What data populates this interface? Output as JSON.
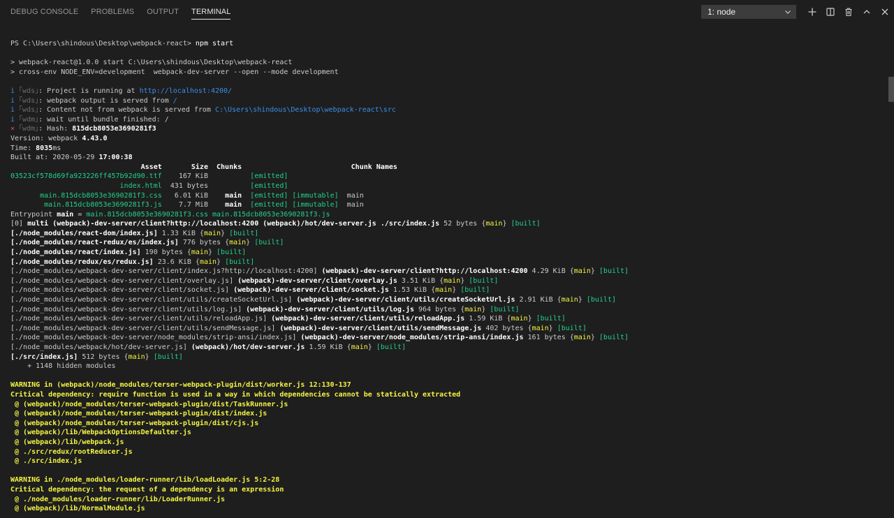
{
  "tabs": [
    {
      "label": "DEBUG CONSOLE",
      "active": false
    },
    {
      "label": "PROBLEMS",
      "active": false
    },
    {
      "label": "OUTPUT",
      "active": false
    },
    {
      "label": "TERMINAL",
      "active": true
    }
  ],
  "terminal_select": {
    "value": "1: node"
  },
  "icons": [
    "plus-icon",
    "split-icon",
    "trash-icon",
    "chevron-up-icon",
    "close-icon"
  ],
  "colors": {
    "green": "#23d18b",
    "yellow": "#f5f543",
    "blue": "#3b8eea",
    "red": "#f14c4c",
    "gray": "#6d6d6d"
  },
  "terminal_lines": [
    [
      {
        "t": "PS C:\\Users\\shindous\\Desktop\\webpack-react> ",
        "c": "dim"
      },
      {
        "t": "npm start",
        "c": "white"
      }
    ],
    [],
    [
      {
        "t": "> webpack-react@1.0.0 start C:\\Users\\shindous\\Desktop\\webpack-react",
        "c": "dim"
      }
    ],
    [
      {
        "t": "> cross-env NODE_ENV=development  webpack-dev-server --open --mode development",
        "c": "dim"
      }
    ],
    [],
    [
      {
        "t": "i ",
        "c": "blue"
      },
      {
        "t": "｢wds｣",
        "c": "gray"
      },
      {
        "t": ": Project is running at ",
        "c": "dim"
      },
      {
        "t": "http://localhost:4200/",
        "c": "blue"
      }
    ],
    [
      {
        "t": "i ",
        "c": "blue"
      },
      {
        "t": "｢wds｣",
        "c": "gray"
      },
      {
        "t": ": webpack output is served from ",
        "c": "dim"
      },
      {
        "t": "/",
        "c": "blue"
      }
    ],
    [
      {
        "t": "i ",
        "c": "blue"
      },
      {
        "t": "｢wds｣",
        "c": "gray"
      },
      {
        "t": ": Content not from webpack is served from ",
        "c": "dim"
      },
      {
        "t": "C:\\Users\\shindous\\Desktop\\webpack-react\\src",
        "c": "blue"
      }
    ],
    [
      {
        "t": "i ",
        "c": "blue"
      },
      {
        "t": "｢wdm｣",
        "c": "gray"
      },
      {
        "t": ": wait until bundle finished: /",
        "c": "dim"
      }
    ],
    [
      {
        "t": "× ",
        "c": "red"
      },
      {
        "t": "｢wdm｣",
        "c": "gray"
      },
      {
        "t": ": Hash: ",
        "c": "dim"
      },
      {
        "t": "815dcb8053e3690281f3",
        "c": "bold"
      }
    ],
    [
      {
        "t": "Version: webpack ",
        "c": "dim"
      },
      {
        "t": "4.43.0",
        "c": "bold"
      }
    ],
    [
      {
        "t": "Time: ",
        "c": "dim"
      },
      {
        "t": "8035",
        "c": "bold"
      },
      {
        "t": "ms",
        "c": "dim"
      }
    ],
    [
      {
        "t": "Built at: 2020-05-29 ",
        "c": "dim"
      },
      {
        "t": "17:00:38",
        "c": "bold"
      }
    ],
    [
      {
        "t": "                               Asset       Size  Chunks                          Chunk Names",
        "c": "bold"
      }
    ],
    [
      {
        "t": "03523cf578d69fa923226ff457b92d90.ttf",
        "c": "green"
      },
      {
        "t": "    167 KiB          ",
        "c": "dim"
      },
      {
        "t": "[emitted]",
        "c": "green"
      }
    ],
    [
      {
        "t": "                          index.html",
        "c": "green"
      },
      {
        "t": "  431 bytes          ",
        "c": "dim"
      },
      {
        "t": "[emitted]",
        "c": "green"
      }
    ],
    [
      {
        "t": "       main.815dcb8053e3690281f3.css",
        "c": "green"
      },
      {
        "t": "   6.01 KiB    ",
        "c": "dim"
      },
      {
        "t": "main",
        "c": "bold"
      },
      {
        "t": "  ",
        "c": "dim"
      },
      {
        "t": "[emitted] [immutable]",
        "c": "green"
      },
      {
        "t": "  main",
        "c": "dim"
      }
    ],
    [
      {
        "t": "        main.815dcb8053e3690281f3.js",
        "c": "green"
      },
      {
        "t": "    7.7 MiB    ",
        "c": "dim"
      },
      {
        "t": "main",
        "c": "bold"
      },
      {
        "t": "  ",
        "c": "dim"
      },
      {
        "t": "[emitted] [immutable]",
        "c": "green"
      },
      {
        "t": "  main",
        "c": "dim"
      }
    ],
    [
      {
        "t": "Entrypoint ",
        "c": "dim"
      },
      {
        "t": "main",
        "c": "bold"
      },
      {
        "t": " = ",
        "c": "dim"
      },
      {
        "t": "main.815dcb8053e3690281f3.css main.815dcb8053e3690281f3.js",
        "c": "green"
      }
    ],
    [
      {
        "t": "[0] ",
        "c": "dim"
      },
      {
        "t": "multi (webpack)-dev-server/client?http://localhost:4200 (webpack)/hot/dev-server.js ./src/index.js",
        "c": "bold"
      },
      {
        "t": " 52 bytes {",
        "c": "dim"
      },
      {
        "t": "main",
        "c": "yellow"
      },
      {
        "t": "} ",
        "c": "dim"
      },
      {
        "t": "[built]",
        "c": "green"
      }
    ],
    [
      {
        "t": "[./node_modules/react-dom/index.js]",
        "c": "bold"
      },
      {
        "t": " 1.33 KiB {",
        "c": "dim"
      },
      {
        "t": "main",
        "c": "yellow"
      },
      {
        "t": "} ",
        "c": "dim"
      },
      {
        "t": "[built]",
        "c": "green"
      }
    ],
    [
      {
        "t": "[./node_modules/react-redux/es/index.js]",
        "c": "bold"
      },
      {
        "t": " 776 bytes {",
        "c": "dim"
      },
      {
        "t": "main",
        "c": "yellow"
      },
      {
        "t": "} ",
        "c": "dim"
      },
      {
        "t": "[built]",
        "c": "green"
      }
    ],
    [
      {
        "t": "[./node_modules/react/index.js]",
        "c": "bold"
      },
      {
        "t": " 190 bytes {",
        "c": "dim"
      },
      {
        "t": "main",
        "c": "yellow"
      },
      {
        "t": "} ",
        "c": "dim"
      },
      {
        "t": "[built]",
        "c": "green"
      }
    ],
    [
      {
        "t": "[./node_modules/redux/es/redux.js]",
        "c": "bold"
      },
      {
        "t": " 23.6 KiB {",
        "c": "dim"
      },
      {
        "t": "main",
        "c": "yellow"
      },
      {
        "t": "} ",
        "c": "dim"
      },
      {
        "t": "[built]",
        "c": "green"
      }
    ],
    [
      {
        "t": "[./node_modules/webpack-dev-server/client/index.js?http://localhost:4200]",
        "c": "dim"
      },
      {
        "t": " (webpack)-dev-server/client?http://localhost:4200",
        "c": "bold"
      },
      {
        "t": " 4.29 KiB {",
        "c": "dim"
      },
      {
        "t": "main",
        "c": "yellow"
      },
      {
        "t": "} ",
        "c": "dim"
      },
      {
        "t": "[built]",
        "c": "green"
      }
    ],
    [
      {
        "t": "[./node_modules/webpack-dev-server/client/overlay.js]",
        "c": "dim"
      },
      {
        "t": " (webpack)-dev-server/client/overlay.js",
        "c": "bold"
      },
      {
        "t": " 3.51 KiB {",
        "c": "dim"
      },
      {
        "t": "main",
        "c": "yellow"
      },
      {
        "t": "} ",
        "c": "dim"
      },
      {
        "t": "[built]",
        "c": "green"
      }
    ],
    [
      {
        "t": "[./node_modules/webpack-dev-server/client/socket.js]",
        "c": "dim"
      },
      {
        "t": " (webpack)-dev-server/client/socket.js",
        "c": "bold"
      },
      {
        "t": " 1.53 KiB {",
        "c": "dim"
      },
      {
        "t": "main",
        "c": "yellow"
      },
      {
        "t": "} ",
        "c": "dim"
      },
      {
        "t": "[built]",
        "c": "green"
      }
    ],
    [
      {
        "t": "[./node_modules/webpack-dev-server/client/utils/createSocketUrl.js]",
        "c": "dim"
      },
      {
        "t": " (webpack)-dev-server/client/utils/createSocketUrl.js",
        "c": "bold"
      },
      {
        "t": " 2.91 KiB {",
        "c": "dim"
      },
      {
        "t": "main",
        "c": "yellow"
      },
      {
        "t": "} ",
        "c": "dim"
      },
      {
        "t": "[built]",
        "c": "green"
      }
    ],
    [
      {
        "t": "[./node_modules/webpack-dev-server/client/utils/log.js]",
        "c": "dim"
      },
      {
        "t": " (webpack)-dev-server/client/utils/log.js",
        "c": "bold"
      },
      {
        "t": " 964 bytes {",
        "c": "dim"
      },
      {
        "t": "main",
        "c": "yellow"
      },
      {
        "t": "} ",
        "c": "dim"
      },
      {
        "t": "[built]",
        "c": "green"
      }
    ],
    [
      {
        "t": "[./node_modules/webpack-dev-server/client/utils/reloadApp.js]",
        "c": "dim"
      },
      {
        "t": " (webpack)-dev-server/client/utils/reloadApp.js",
        "c": "bold"
      },
      {
        "t": " 1.59 KiB {",
        "c": "dim"
      },
      {
        "t": "main",
        "c": "yellow"
      },
      {
        "t": "} ",
        "c": "dim"
      },
      {
        "t": "[built]",
        "c": "green"
      }
    ],
    [
      {
        "t": "[./node_modules/webpack-dev-server/client/utils/sendMessage.js]",
        "c": "dim"
      },
      {
        "t": " (webpack)-dev-server/client/utils/sendMessage.js",
        "c": "bold"
      },
      {
        "t": " 402 bytes {",
        "c": "dim"
      },
      {
        "t": "main",
        "c": "yellow"
      },
      {
        "t": "} ",
        "c": "dim"
      },
      {
        "t": "[built]",
        "c": "green"
      }
    ],
    [
      {
        "t": "[./node_modules/webpack-dev-server/node_modules/strip-ansi/index.js]",
        "c": "dim"
      },
      {
        "t": " (webpack)-dev-server/node_modules/strip-ansi/index.js",
        "c": "bold"
      },
      {
        "t": " 161 bytes {",
        "c": "dim"
      },
      {
        "t": "main",
        "c": "yellow"
      },
      {
        "t": "} ",
        "c": "dim"
      },
      {
        "t": "[built]",
        "c": "green"
      }
    ],
    [
      {
        "t": "[./node_modules/webpack/hot/dev-server.js]",
        "c": "dim"
      },
      {
        "t": " (webpack)/hot/dev-server.js",
        "c": "bold"
      },
      {
        "t": " 1.59 KiB {",
        "c": "dim"
      },
      {
        "t": "main",
        "c": "yellow"
      },
      {
        "t": "} ",
        "c": "dim"
      },
      {
        "t": "[built]",
        "c": "green"
      }
    ],
    [
      {
        "t": "[./src/index.js]",
        "c": "bold"
      },
      {
        "t": " 512 bytes {",
        "c": "dim"
      },
      {
        "t": "main",
        "c": "yellow"
      },
      {
        "t": "} ",
        "c": "dim"
      },
      {
        "t": "[built]",
        "c": "green"
      }
    ],
    [
      {
        "t": "    + 1148 hidden modules",
        "c": "dim"
      }
    ],
    [],
    [
      {
        "t": "WARNING in (webpack)/node_modules/terser-webpack-plugin/dist/worker.js 12:130-137",
        "c": "yellowb"
      }
    ],
    [
      {
        "t": "Critical dependency: require function is used in a way in which dependencies cannot be statically extracted",
        "c": "yellowb"
      }
    ],
    [
      {
        "t": " @ (webpack)/node_modules/terser-webpack-plugin/dist/TaskRunner.js",
        "c": "yellowb"
      }
    ],
    [
      {
        "t": " @ (webpack)/node_modules/terser-webpack-plugin/dist/index.js",
        "c": "yellowb"
      }
    ],
    [
      {
        "t": " @ (webpack)/node_modules/terser-webpack-plugin/dist/cjs.js",
        "c": "yellowb"
      }
    ],
    [
      {
        "t": " @ (webpack)/lib/WebpackOptionsDefaulter.js",
        "c": "yellowb"
      }
    ],
    [
      {
        "t": " @ (webpack)/lib/webpack.js",
        "c": "yellowb"
      }
    ],
    [
      {
        "t": " @ ./src/redux/rootReducer.js",
        "c": "yellowb"
      }
    ],
    [
      {
        "t": " @ ./src/index.js",
        "c": "yellowb"
      }
    ],
    [],
    [
      {
        "t": "WARNING in ./node_modules/loader-runner/lib/loadLoader.js 5:2-28",
        "c": "yellowb"
      }
    ],
    [
      {
        "t": "Critical dependency: the request of a dependency is an expression",
        "c": "yellowb"
      }
    ],
    [
      {
        "t": " @ ./node_modules/loader-runner/lib/LoaderRunner.js",
        "c": "yellowb"
      }
    ],
    [
      {
        "t": " @ (webpack)/lib/NormalModule.js",
        "c": "yellowb"
      }
    ]
  ]
}
